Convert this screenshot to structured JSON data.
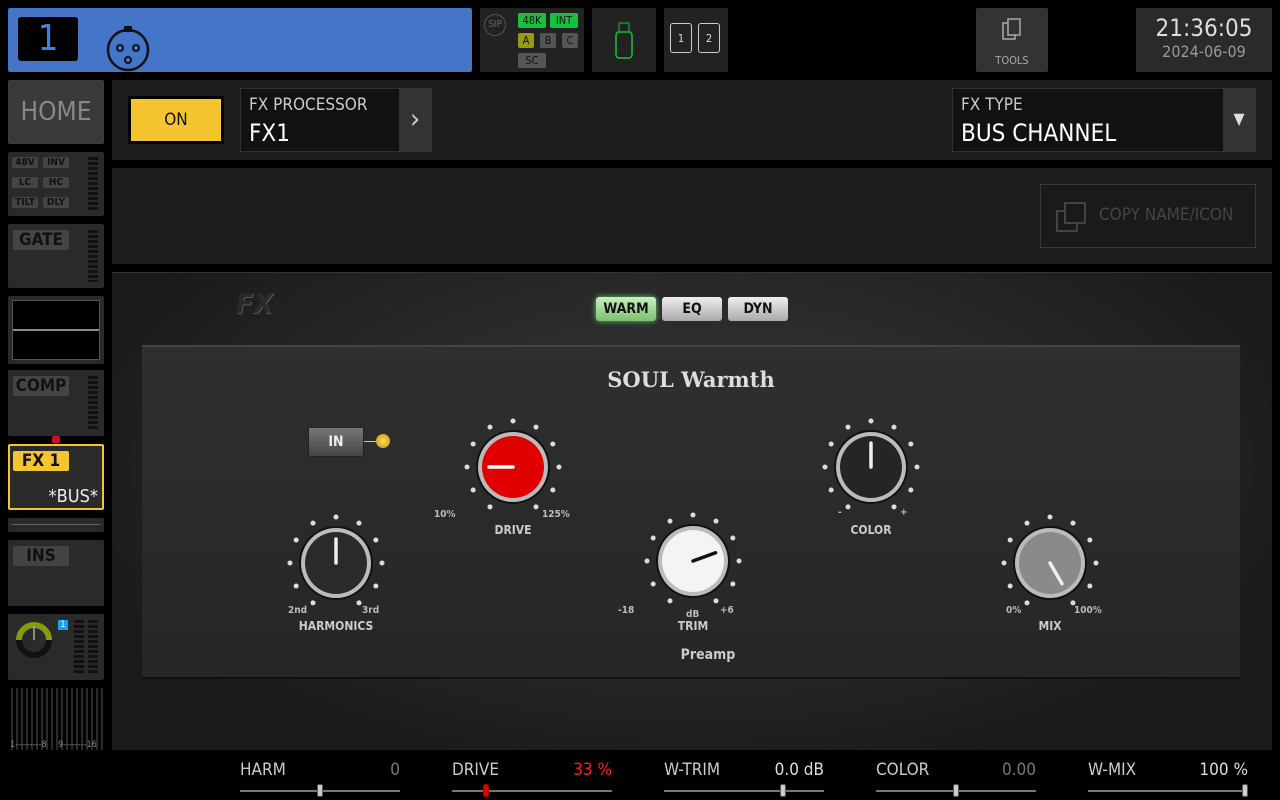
{
  "header": {
    "channel_number": "1",
    "channel_icon": "xlr-connector-icon",
    "sync": {
      "sip": "SIP",
      "rate": "48K",
      "clock": "INT",
      "a": "A",
      "b": "B",
      "c": "C",
      "sc": "SC"
    },
    "usb_icon": "usb-icon",
    "cards": [
      "1",
      "2"
    ],
    "tools_label": "TOOLS",
    "time": "21:36:05",
    "date": "2024-06-09"
  },
  "sidebar": {
    "home": "HOME",
    "preamp": [
      "48V",
      "INV",
      "LC",
      "HC",
      "TILT",
      "DLY"
    ],
    "gate": "GATE",
    "comp": "COMP",
    "fx": "FX 1",
    "fx_sub": "*BUS*",
    "ins": "INS",
    "bank_labels": [
      "1---------8",
      "9--------16"
    ],
    "send_badge": "1"
  },
  "toolbar": {
    "on": "ON",
    "fx_processor_label": "FX PROCESSOR",
    "fx_processor": "FX1",
    "fx_type_label": "FX TYPE",
    "fx_type": "BUS CHANNEL",
    "copy": "COPY NAME/ICON"
  },
  "plugin": {
    "logo": "FX",
    "tabs": [
      "WARM",
      "EQ",
      "DYN"
    ],
    "active_tab": "WARM",
    "title": "SOUL Warmth",
    "in": "IN",
    "section": "Preamp",
    "knobs": {
      "harmonics": {
        "label": "HARMONICS",
        "min": "2nd",
        "max": "3rd"
      },
      "drive": {
        "label": "DRIVE",
        "min": "10%",
        "max": "125%"
      },
      "trim": {
        "label": "TRIM",
        "min": "-18",
        "mid": "dB",
        "max": "+6"
      },
      "color": {
        "label": "COLOR",
        "min": "-",
        "max": "+"
      },
      "mix": {
        "label": "MIX",
        "min": "0%",
        "max": "100%"
      }
    }
  },
  "params": [
    {
      "name": "HARM",
      "value": "0",
      "fraction": 0.5
    },
    {
      "name": "DRIVE",
      "value": "33 %",
      "fraction": 0.2
    },
    {
      "name": "W-TRIM",
      "value": "0.0 dB",
      "fraction": 0.75
    },
    {
      "name": "COLOR",
      "value": "0.00",
      "fraction": 0.5
    },
    {
      "name": "W-MIX",
      "value": "100 %",
      "fraction": 1.0
    }
  ],
  "colors": {
    "accent": "#f5c531",
    "channel": "#4475c8",
    "drive": "#e00000",
    "green": "#18c040"
  }
}
